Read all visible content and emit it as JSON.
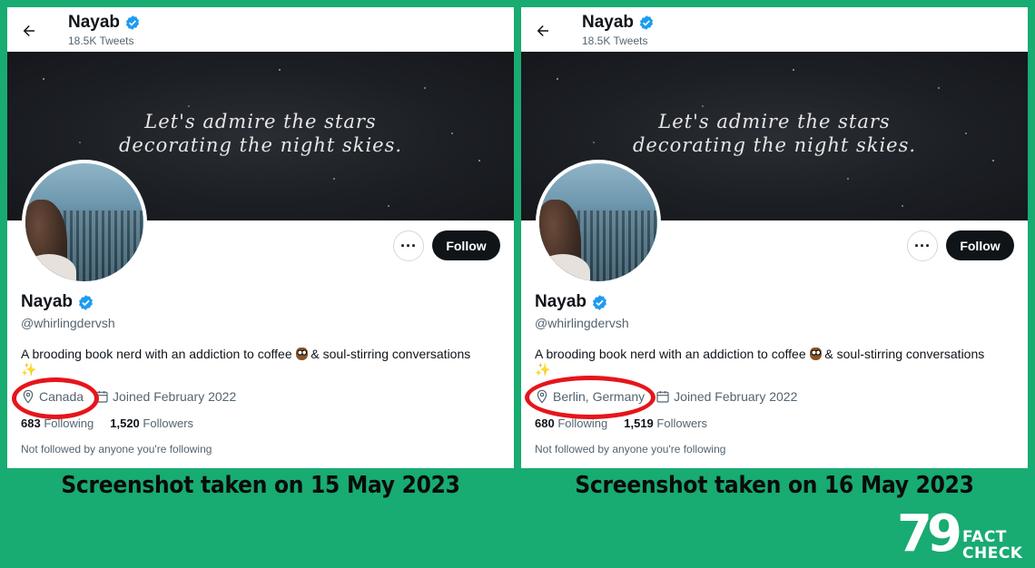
{
  "screenshots": [
    {
      "header": {
        "name": "Nayab",
        "tweets": "18.5K Tweets"
      },
      "banner_text": [
        "Let's admire the stars",
        "decorating the night skies."
      ],
      "profile": {
        "name": "Nayab",
        "handle": "@whirlingdervsh",
        "bio": "A brooding book nerd with an addiction to coffee",
        "bio_rest": "& soul-stirring conversations",
        "location": "Canada",
        "joined": "Joined February 2022",
        "following_count": "683",
        "following_label": "Following",
        "followers_count": "1,520",
        "followers_label": "Followers",
        "not_followed": "Not followed by anyone you're following"
      },
      "follow_label": "Follow",
      "more_label": "···",
      "caption": "Screenshot taken on 15 May 2023"
    },
    {
      "header": {
        "name": "Nayab",
        "tweets": "18.5K Tweets"
      },
      "banner_text": [
        "Let's admire the stars",
        "decorating the night skies."
      ],
      "profile": {
        "name": "Nayab",
        "handle": "@whirlingdervsh",
        "bio": "A brooding book nerd with an addiction to coffee",
        "bio_rest": "& soul-stirring conversations",
        "location": "Berlin, Germany",
        "joined": "Joined February 2022",
        "following_count": "680",
        "following_label": "Following",
        "followers_count": "1,519",
        "followers_label": "Followers",
        "not_followed": "Not followed by anyone you're following"
      },
      "follow_label": "Follow",
      "more_label": "···",
      "caption": "Screenshot taken on 16 May 2023"
    }
  ],
  "logo": {
    "number": "79",
    "line1": "FACT",
    "line2": "CHECK"
  },
  "colors": {
    "background": "#18ab72",
    "highlight": "#e6151b",
    "verified": "#1d9bf0"
  }
}
